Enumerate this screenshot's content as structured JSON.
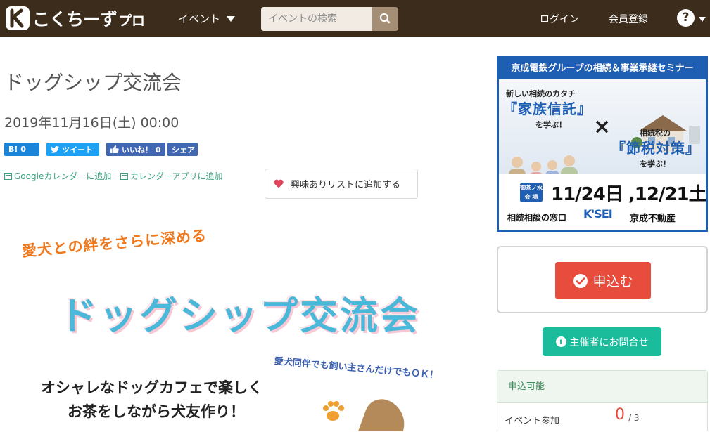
{
  "header": {
    "logo_text": "こくちーず",
    "logo_suffix": "プロ",
    "nav_event": "イベント",
    "search_placeholder": "イベントの検索",
    "login": "ログイン",
    "register": "会員登録",
    "help": "?"
  },
  "event": {
    "title": "ドッグシップ交流会",
    "date": "2019年11月16日(土) 00:00"
  },
  "share": {
    "hatena": "B! 0",
    "tweet": "ツイート",
    "like": "いいね！ 0",
    "fb_share": "シェア"
  },
  "calendar": {
    "google": "Googleカレンダーに追加",
    "app": "カレンダーアプリに追加"
  },
  "interest_button": "興味ありリストに追加する",
  "flyer": {
    "subtitle": "愛犬との絆をさらに深める",
    "title": "ドッグシップ交流会",
    "note": "愛犬同伴でも飼い主さんだけでもＯＫ！",
    "line1": "オシャレなドッグカフェで楽しく",
    "line2": "お茶をしながら犬友作り！"
  },
  "ad": {
    "heading": "京成電鉄グループの相続＆事業承継セミナー",
    "t1": "新しい相続のカタチ",
    "t2": "『家族信託』",
    "t3": "を学ぶ！",
    "x": "×",
    "t4": "相続税の",
    "t5": "『節税対策』",
    "t6": "を学ぶ！",
    "venue": "御茶ノ水 会 場",
    "dates": "11/24日 ,12/21土",
    "window": "相続相談の窓口",
    "logo": "K'SEI",
    "company": "京成不動産"
  },
  "apply": {
    "button": "申込む",
    "contact": "主催者にお問合せ"
  },
  "availability": {
    "status": "申込可能",
    "label": "イベント参加",
    "count": "0",
    "total": "/ 3"
  },
  "colors": {
    "header_bg": "#3b2c1c",
    "apply": "#e74c3c",
    "contact": "#1abc9c",
    "ad_blue": "#1e5fb4"
  }
}
